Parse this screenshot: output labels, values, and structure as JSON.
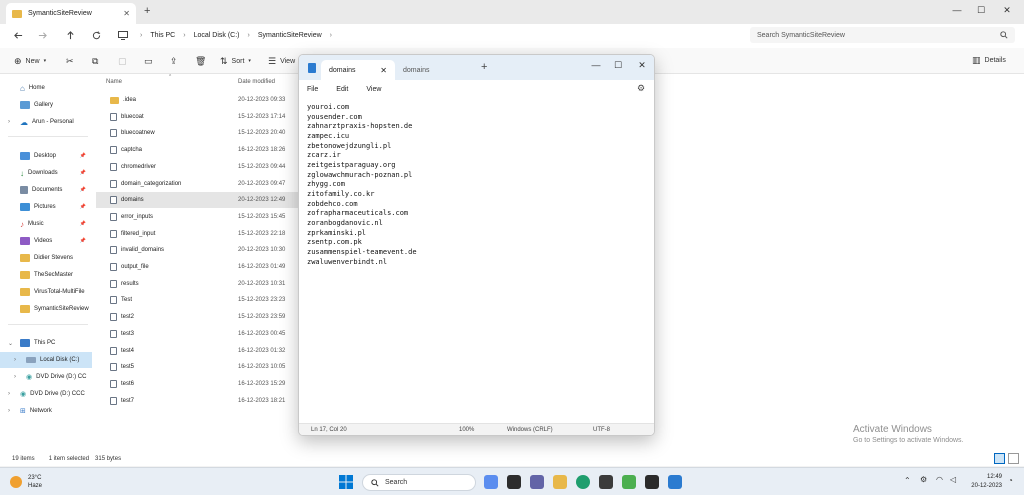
{
  "explorer": {
    "tab_title": "SymanticSiteReview",
    "breadcrumbs": [
      "This PC",
      "Local Disk (C:)",
      "SymanticSiteReview"
    ],
    "search_placeholder": "Search SymanticSiteReview",
    "toolbar": {
      "new_label": "New",
      "sort_label": "Sort",
      "view_label": "View",
      "details_label": "Details"
    },
    "sidebar": {
      "top": [
        "Home",
        "Gallery",
        "Arun - Personal"
      ],
      "pinned": [
        "Desktop",
        "Downloads",
        "Documents",
        "Pictures",
        "Music",
        "Videos",
        "Didier Stevens",
        "TheSecMaster",
        "VirusTotal-MultiFile",
        "SymanticSiteReview"
      ],
      "devices": [
        "This PC",
        "Local Disk (C:)",
        "DVD Drive (D:) CC",
        "DVD Drive (D:) CCC",
        "Network"
      ]
    },
    "columns": {
      "name": "Name",
      "date": "Date modified"
    },
    "files": [
      {
        "name": ".idea",
        "date": "20-12-2023 09:33",
        "kind": "folder"
      },
      {
        "name": "bluecoat",
        "date": "15-12-2023 17:14",
        "kind": "file"
      },
      {
        "name": "bluecoatnew",
        "date": "15-12-2023 20:40",
        "kind": "file"
      },
      {
        "name": "captcha",
        "date": "16-12-2023 18:26",
        "kind": "file"
      },
      {
        "name": "chromedriver",
        "date": "15-12-2023 09:44",
        "kind": "file"
      },
      {
        "name": "domain_categorization",
        "date": "20-12-2023 09:47",
        "kind": "file"
      },
      {
        "name": "domains",
        "date": "20-12-2023 12:49",
        "kind": "file"
      },
      {
        "name": "error_inputs",
        "date": "15-12-2023 15:45",
        "kind": "file"
      },
      {
        "name": "filtered_input",
        "date": "15-12-2023 22:18",
        "kind": "file"
      },
      {
        "name": "invalid_domains",
        "date": "20-12-2023 10:30",
        "kind": "file"
      },
      {
        "name": "output_file",
        "date": "16-12-2023 01:49",
        "kind": "file"
      },
      {
        "name": "results",
        "date": "20-12-2023 10:31",
        "kind": "file"
      },
      {
        "name": "Test",
        "date": "15-12-2023 23:23",
        "kind": "file"
      },
      {
        "name": "test2",
        "date": "15-12-2023 23:59",
        "kind": "file"
      },
      {
        "name": "test3",
        "date": "16-12-2023 00:45",
        "kind": "file"
      },
      {
        "name": "test4",
        "date": "16-12-2023 01:32",
        "kind": "file"
      },
      {
        "name": "test5",
        "date": "16-12-2023 10:05",
        "kind": "file"
      },
      {
        "name": "test6",
        "date": "16-12-2023 15:29",
        "kind": "file"
      },
      {
        "name": "test7",
        "date": "16-12-2023 18:21",
        "kind": "file"
      }
    ],
    "status": {
      "items": "19 items",
      "selected": "1 item selected",
      "size": "315 bytes"
    }
  },
  "notepad": {
    "tabs": [
      "domains",
      "domains"
    ],
    "menu": [
      "File",
      "Edit",
      "View"
    ],
    "lines": [
      "youroi.com",
      "yousender.com",
      "zahnarztpraxis-hopsten.de",
      "zampec.icu",
      "zbetonowejdzungli.pl",
      "zcarz.ir",
      "zeitgeistparaguay.org",
      "zglowawchmurach-poznan.pl",
      "zhygg.com",
      "zitofamily.co.kr",
      "zobdehco.com",
      "zofrapharmaceuticals.com",
      "zoranbogdanovic.nl",
      "zprkaminski.pl",
      "zsentp.com.pk",
      "zusammenspiel-teamevent.de",
      "zwaluwenverbindt.nl"
    ],
    "status": {
      "position": "Ln 17, Col 20",
      "zoom": "100%",
      "line_ending": "Windows (CRLF)",
      "encoding": "UTF-8"
    }
  },
  "watermark": {
    "title": "Activate Windows",
    "subtitle": "Go to Settings to activate Windows."
  },
  "taskbar": {
    "weather_temp": "23°C",
    "weather_desc": "Haze",
    "search_label": "Search",
    "time": "12:49",
    "date": "20-12-2023"
  },
  "colors": {
    "accent": "#0067c0",
    "selection": "#cce4f7",
    "folder": "#e8b84a"
  }
}
